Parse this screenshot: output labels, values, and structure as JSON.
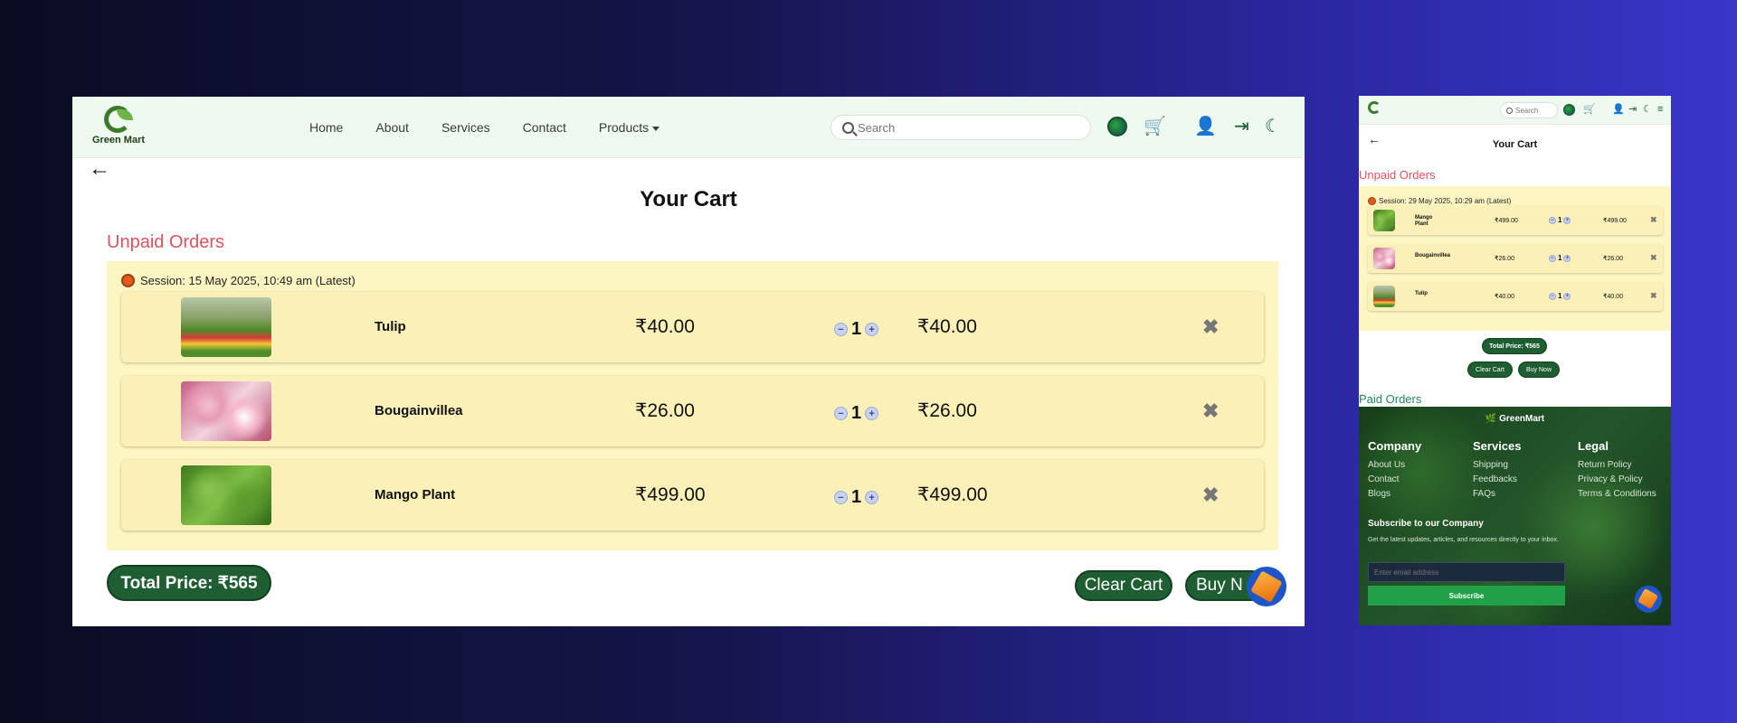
{
  "desktop": {
    "brand": "Green Mart",
    "nav": [
      "Home",
      "About",
      "Services",
      "Contact",
      "Products"
    ],
    "search_placeholder": "Search",
    "icons": [
      "globe-icon",
      "cart-icon",
      "user-icon",
      "login-icon",
      "moon-icon"
    ],
    "title": "Your Cart",
    "unpaid_heading": "Unpaid Orders",
    "session_label": "Session: 15 May 2025, 10:49 am (Latest)",
    "items": [
      {
        "name": "Tulip",
        "price": "₹40.00",
        "qty": "1",
        "total": "₹40.00",
        "image": "tulip"
      },
      {
        "name": "Bougainvillea",
        "price": "₹26.00",
        "qty": "1",
        "total": "₹26.00",
        "image": "bougainvillea"
      },
      {
        "name": "Mango Plant",
        "price": "₹499.00",
        "qty": "1",
        "total": "₹499.00",
        "image": "mango"
      }
    ],
    "total_price": "Total Price: ₹565",
    "clear_cart": "Clear Cart",
    "buy_now": "Buy N"
  },
  "mobile": {
    "search_placeholder": "Search",
    "title": "Your Cart",
    "unpaid_heading": "Unpaid Orders",
    "session_label": "Session: 29 May 2025, 10:29 am (Latest)",
    "items": [
      {
        "name": "Mango Plant",
        "price": "₹499.00",
        "qty": "1",
        "total": "₹499.00",
        "image": "mango"
      },
      {
        "name": "Bougainvillea",
        "price": "₹26.00",
        "qty": "1",
        "total": "₹26.00",
        "image": "bougainvillea"
      },
      {
        "name": "Tulip",
        "price": "₹40.00",
        "qty": "1",
        "total": "₹40.00",
        "image": "tulip"
      }
    ],
    "total_price": "Total Price: ₹565",
    "clear_cart": "Clear Cart",
    "buy_now": "Buy Now",
    "paid_heading": "Paid Orders",
    "footer": {
      "brand": "GreenMart",
      "columns": [
        {
          "title": "Company",
          "links": [
            "About Us",
            "Contact",
            "Blogs"
          ]
        },
        {
          "title": "Services",
          "links": [
            "Shipping",
            "Feedbacks",
            "FAQs"
          ]
        },
        {
          "title": "Legal",
          "links": [
            "Return Policy",
            "Privacy & Policy",
            "Terms & Conditions"
          ]
        }
      ],
      "subscribe_title": "Subscribe to our Company",
      "subscribe_desc": "Get the latest updates, articles, and resources directly to your inbox.",
      "email_placeholder": "Enter email address",
      "subscribe_button": "Subscribe"
    }
  },
  "colors": {
    "accent_green": "#1f5e33",
    "unpaid_red": "#e0525e",
    "session_bg": "#fdf6c2",
    "nav_bg": "#eefaef"
  }
}
